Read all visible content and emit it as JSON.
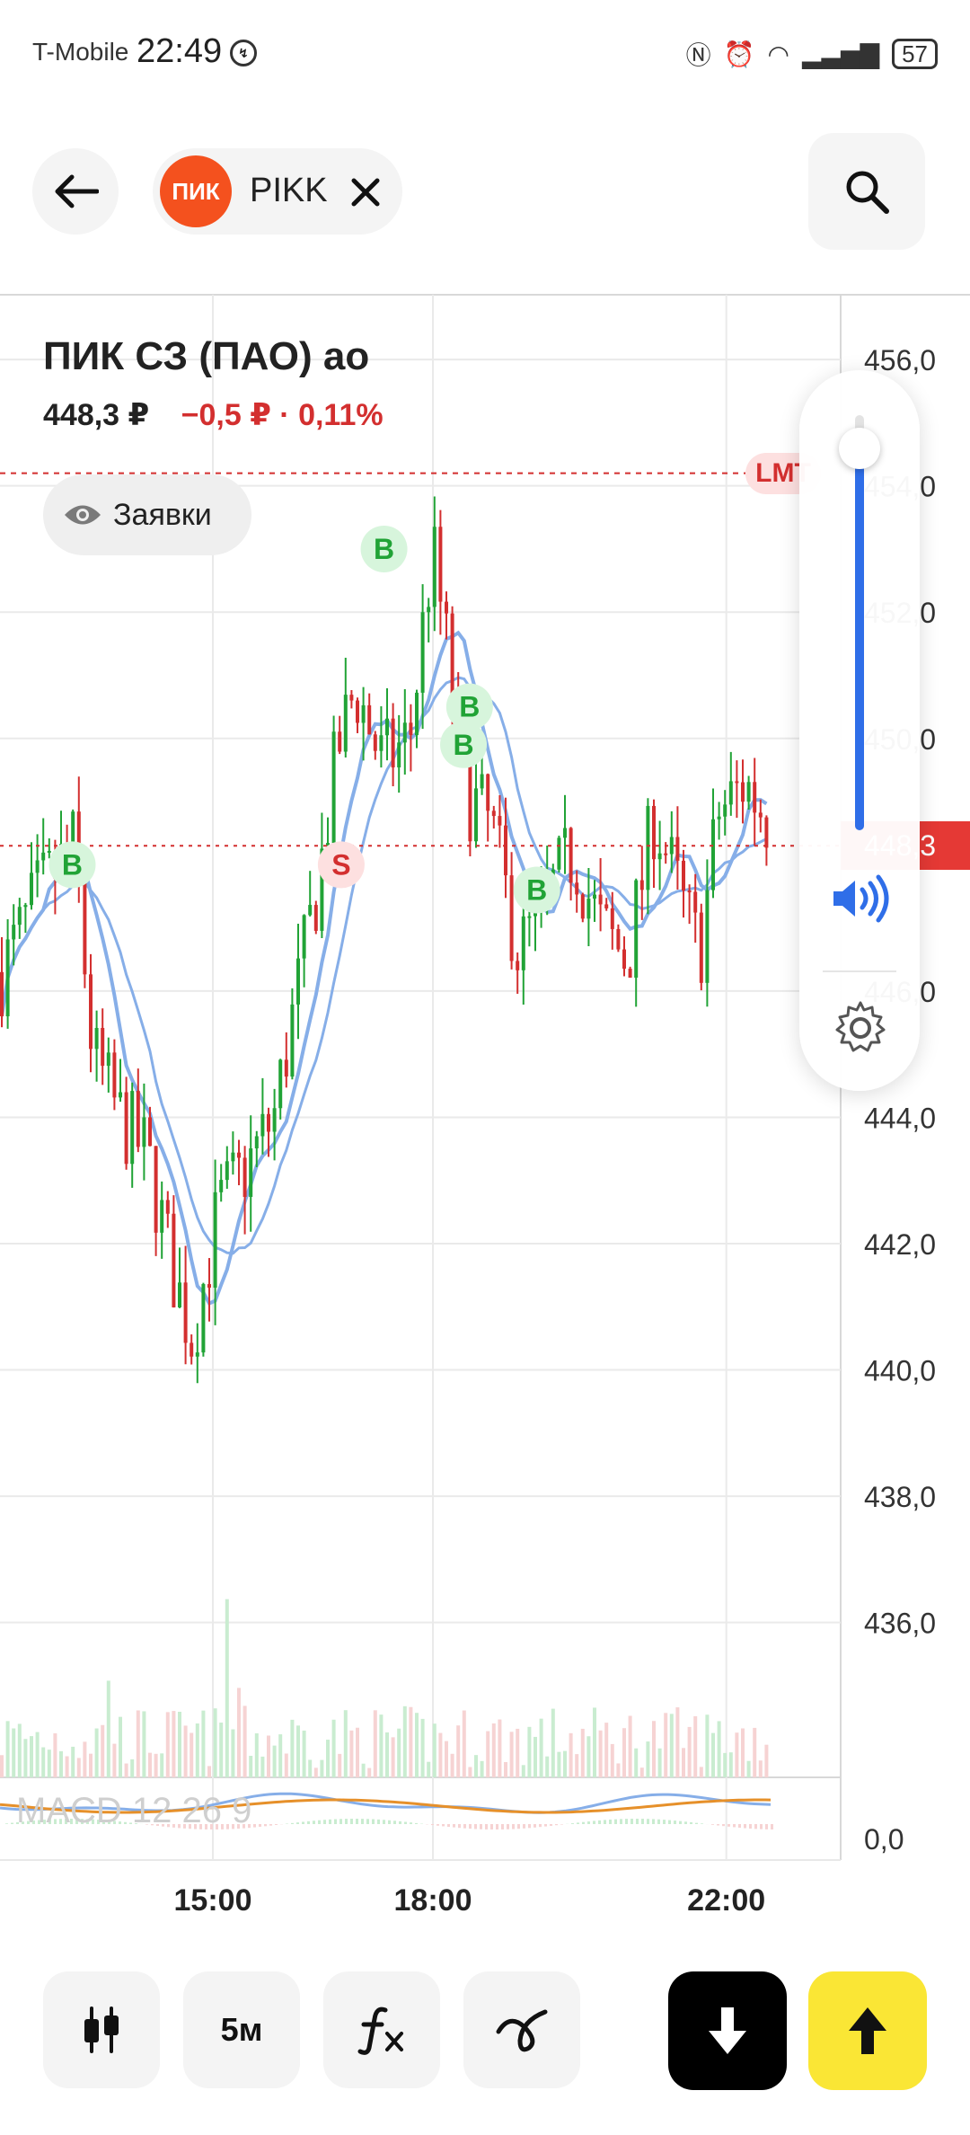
{
  "status_bar": {
    "carrier": "T-Mobile",
    "time": "22:49",
    "battery": "57"
  },
  "header": {
    "ticker_logo_text": "ПИК",
    "ticker": "PIKK"
  },
  "instrument": {
    "name": "ПИК СЗ (ПАО) ао",
    "price": "448,3 ₽",
    "change": "−0,5 ₽ · 0,11%"
  },
  "orders_button": {
    "label": "Заявки"
  },
  "chart_data": {
    "type": "candlestick",
    "y_ticks": [
      "456,0",
      "454,0",
      "452,0",
      "450,0",
      "448,3",
      "446,0",
      "444,0",
      "442,0",
      "440,0",
      "438,0",
      "436,0"
    ],
    "x_ticks": [
      "15:00",
      "18:00",
      "22:00"
    ],
    "ylim": [
      434.8,
      456.4
    ],
    "current_price": 448.3,
    "limit_order_price": 454.2,
    "limit_label": "LMT",
    "indicator": {
      "name": "MACD 12 26 9",
      "zero_label": "0,0"
    },
    "trade_markers": [
      {
        "label": "B",
        "time": "13:05",
        "price": 448.0
      },
      {
        "label": "S",
        "time": "16:45",
        "price": 448.0
      },
      {
        "label": "B",
        "time": "17:20",
        "price": 453.0
      },
      {
        "label": "B",
        "time": "18:30",
        "price": 450.5
      },
      {
        "label": "B",
        "time": "18:25",
        "price": 449.9
      },
      {
        "label": "B",
        "time": "19:25",
        "price": 447.6
      }
    ]
  },
  "volume_panel": {
    "level": 0.92
  },
  "toolbar": {
    "timeframe": "5м",
    "indicators_label": "fx"
  },
  "colors": {
    "up": "#21a336",
    "down": "#d32f2f",
    "ma": "#86aee8",
    "macd_line": "#e6902a",
    "accent_blue": "#2f6ee8",
    "buy": "#fae635"
  }
}
